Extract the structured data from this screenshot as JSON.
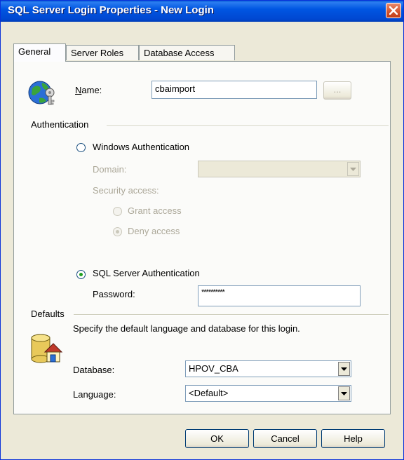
{
  "window": {
    "title": "SQL Server Login Properties - New Login"
  },
  "tabs": [
    {
      "label": "General"
    },
    {
      "label": "Server Roles"
    },
    {
      "label": "Database Access"
    }
  ],
  "general": {
    "name_label": "Name:",
    "name_value": "cbaimport",
    "browse_label": "...",
    "auth_section": "Authentication",
    "windows_auth": "Windows Authentication",
    "domain_label": "Domain:",
    "domain_value": "",
    "security_access_label": "Security access:",
    "grant_access": "Grant access",
    "deny_access": "Deny access",
    "sql_auth": "SQL Server Authentication",
    "password_label": "Password:",
    "password_value": "**********",
    "defaults_section": "Defaults",
    "defaults_desc": "Specify the default language and database for this login.",
    "database_label": "Database:",
    "database_value": "HPOV_CBA",
    "language_label": "Language:",
    "language_value": "<Default>"
  },
  "buttons": {
    "ok": "OK",
    "cancel": "Cancel",
    "help": "Help"
  },
  "state": {
    "auth_selected": "SQL Server Authentication",
    "security_selected": "Deny access"
  },
  "icons": {
    "login": "globe-key-icon",
    "defaults": "database-house-icon",
    "close": "close-icon",
    "dropdown": "chevron-down-icon"
  }
}
